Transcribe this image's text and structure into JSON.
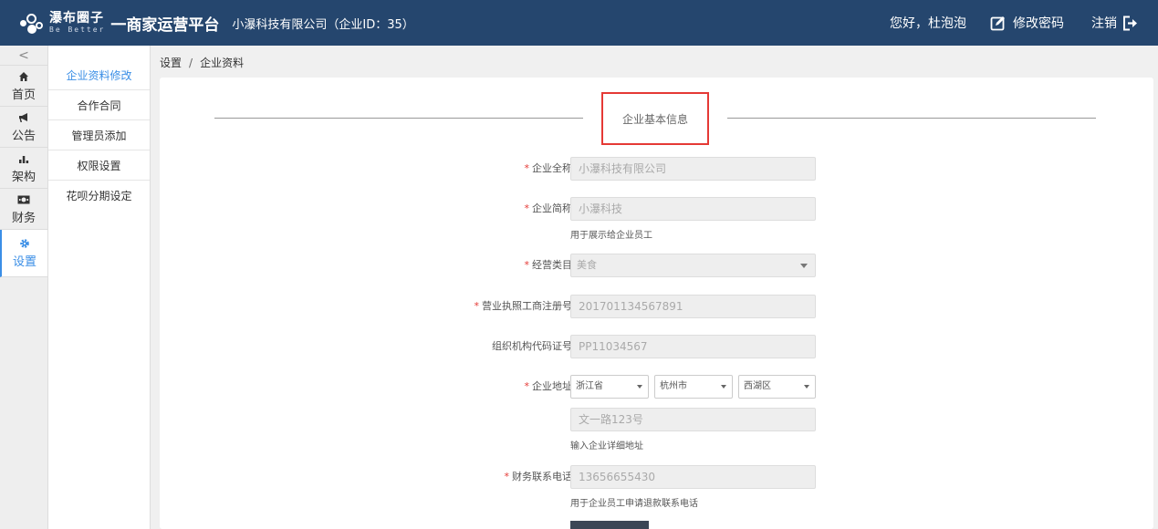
{
  "header": {
    "logo_name": "瀑布圈子",
    "logo_sub": "Be Better",
    "platform": "一商家运营平台",
    "company": "小瀑科技有限公司（企业ID：35）",
    "greeting": "您好，杜泡泡",
    "change_password": "修改密码",
    "logout": "注销"
  },
  "icon_nav": {
    "collapse": "<",
    "items": [
      {
        "label": "首页",
        "icon": "home-icon"
      },
      {
        "label": "公告",
        "icon": "megaphone-icon"
      },
      {
        "label": "架构",
        "icon": "bar-chart-icon"
      },
      {
        "label": "财务",
        "icon": "money-icon"
      },
      {
        "label": "设置",
        "icon": "gear-icon"
      }
    ]
  },
  "sub_nav": {
    "items": [
      {
        "label": "企业资料修改"
      },
      {
        "label": "合作合同"
      },
      {
        "label": "管理员添加"
      },
      {
        "label": "权限设置"
      },
      {
        "label": "花呗分期设定"
      }
    ]
  },
  "breadcrumb": {
    "root": "设置",
    "sep": "/",
    "current": "企业资料"
  },
  "form": {
    "section_title": "企业基本信息",
    "required_mark": "*",
    "full_name_label": "企业全称：",
    "full_name_value": "小瀑科技有限公司",
    "short_name_label": "企业简称：",
    "short_name_value": "小瀑科技",
    "short_name_help": "用于展示给企业员工",
    "category_label": "经营类目：",
    "category_value": "美食",
    "license_label": "营业执照工商注册号：",
    "license_value": "201701134567891",
    "org_code_label": "组织机构代码证号：",
    "org_code_value": "PP11034567",
    "address_label": "企业地址：",
    "province": "浙江省",
    "city": "杭州市",
    "district": "西湖区",
    "address_detail": "文一路123号",
    "address_help": "输入企业详细地址",
    "phone_label": "财务联系电话：",
    "phone_value": "13656655430",
    "phone_help": "用于企业员工申请退款联系电话"
  }
}
